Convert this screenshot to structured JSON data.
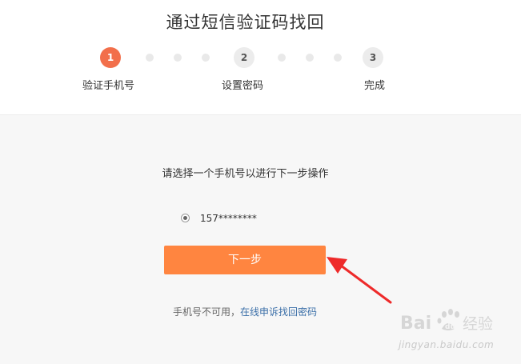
{
  "page": {
    "title": "通过短信验证码找回"
  },
  "steps": [
    {
      "number": "1",
      "label": "验证手机号",
      "state": "active"
    },
    {
      "number": "2",
      "label": "设置密码",
      "state": "pending"
    },
    {
      "number": "3",
      "label": "完成",
      "state": "pending"
    }
  ],
  "form": {
    "prompt": "请选择一个手机号以进行下一步操作",
    "phone_option": "157********",
    "phone_selected": true,
    "next_label": "下一步"
  },
  "footer": {
    "note": "手机号不可用，",
    "appeal_link": "在线申诉找回密码"
  },
  "watermark": {
    "logo_text": "Bai du 经验",
    "url": "jingyan.baidu.com"
  },
  "colors": {
    "accent": "#f26f4b",
    "button": "#ff8540",
    "link": "#3b6fa8",
    "annotation_arrow": "#ee2a2a"
  }
}
